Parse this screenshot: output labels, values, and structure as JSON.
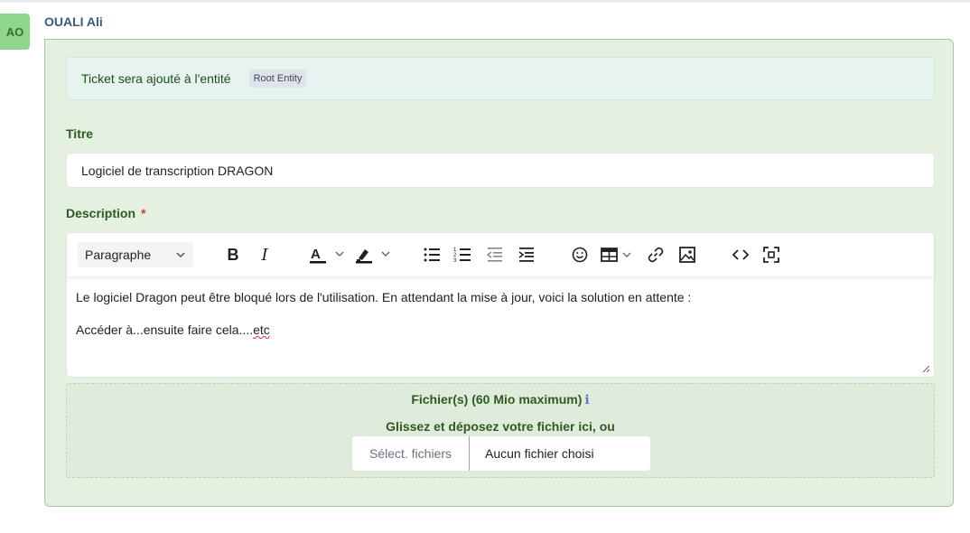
{
  "author": {
    "initials": "AO",
    "name": "OUALI Ali",
    "avatar_color": "#8fd68c"
  },
  "entity": {
    "text": "Ticket sera ajouté à l'entité",
    "badge": "Root Entity"
  },
  "title_field": {
    "label": "Titre",
    "value": "Logiciel de transcription DRAGON"
  },
  "description_field": {
    "label": "Description",
    "required_mark": "*",
    "toolbar": {
      "paragraph_select": "Paragraphe",
      "buttons": [
        "bold-icon",
        "italic-icon",
        "font-color-icon",
        "highlight-icon",
        "bullet-list-icon",
        "numbered-list-icon",
        "outdent-icon",
        "indent-icon",
        "emoji-icon",
        "table-icon",
        "link-icon",
        "image-icon",
        "code-icon",
        "fullscreen-icon"
      ]
    },
    "content": {
      "line1": "Le logiciel Dragon peut être bloqué lors de l'utilisation. En attendant la mise à jour, voici la solution en attente :",
      "line2_prefix": "Accéder à...ensuite faire cela....",
      "line2_misspelled": "etc"
    }
  },
  "files": {
    "title": "Fichier(s) (60 Mio maximum)",
    "info_icon": "ℹ",
    "drop_text": "Glissez et déposez votre fichier ici, ou",
    "select_button": "Sélect. fichiers",
    "no_file": "Aucun fichier choisi"
  },
  "colors": {
    "card_bg": "#e4f1e1",
    "card_border": "#9ccc97",
    "label_green": "#2e5a23",
    "required_red": "#d63939"
  }
}
